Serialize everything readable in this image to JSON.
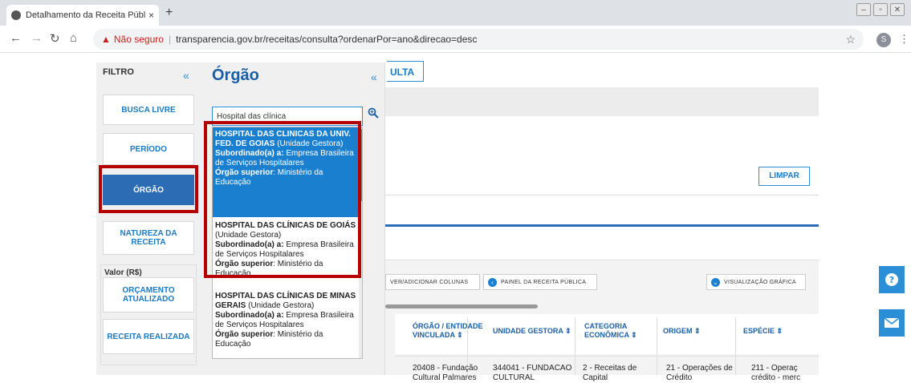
{
  "browser": {
    "tab_title": "Detalhamento da Receita Pública - P",
    "tab_close": "×",
    "new_tab": "+",
    "not_secure": "Não seguro",
    "url": "transparencia.gov.br/receitas/consulta?ordenarPor=ano&direcao=desc",
    "profile_initial": "S"
  },
  "filtro": {
    "title": "FILTRO",
    "collapse": "«",
    "buttons": {
      "busca_livre": "BUSCA LIVRE",
      "periodo": "PERÍODO",
      "orgao": "ÓRGÃO",
      "natureza": "NATUREZA DA RECEITA",
      "valor_title": "Valor (R$)",
      "orcamento": "ORÇAMENTO ATUALIZADO",
      "realizada": "RECEITA REALIZADA"
    }
  },
  "orgao_panel": {
    "title": "Órgão",
    "collapse": "«",
    "search_value": "Hospital das clínica",
    "results": [
      {
        "name": "HOSPITAL DAS CLINICAS DA UNIV. FED. DE GOIAS",
        "type": " (Unidade Gestora)",
        "sub_label": "Subordinado(a) a:",
        "sub_value": " Empresa Brasileira de Serviços Hospitalares",
        "sup_label": "Órgão superior",
        "sup_value": ": Ministério da Educação"
      },
      {
        "name": "HOSPITAL DAS CLÍNICAS DE GOIÁS",
        "type": " (Unidade Gestora)",
        "sub_label": "Subordinado(a) a:",
        "sub_value": " Empresa Brasileira de Serviços Hospitalares",
        "sup_label": "Órgão superior",
        "sup_value": ": Ministério da Educação"
      },
      {
        "name": "HOSPITAL DAS CLÍNICAS DE MINAS GERAIS",
        "type": " (Unidade Gestora)",
        "sub_label": "Subordinado(a) a:",
        "sub_value": " Empresa Brasileira de Serviços Hospitalares",
        "sup_label": "Órgão superior",
        "sup_value": ": Ministério da Educação"
      }
    ]
  },
  "main": {
    "consulta_tab": "ULTA",
    "limpar": "LIMPAR",
    "toolbar": {
      "colunas": "VER/ADICIONAR COLUNAS",
      "painel": "PAINEL DA RECEITA PÚBLICA",
      "grafica": "VISUALIZAÇÃO GRÁFICA"
    },
    "columns": [
      "ÓRGÃO / ENTIDADE VINCULADA ⇕",
      "UNIDADE GESTORA ⇕",
      "CATEGORIA ECONÔMICA ⇕",
      "ORIGEM ⇕",
      "ESPÉCIE ⇕"
    ],
    "row": [
      "20408 - Fundação Cultural Palmares",
      "344041 - FUNDACAO CULTURAL",
      "2 - Receitas de Capital",
      "21 - Operações de Crédito",
      "211 - Operaç crédito - merc"
    ]
  }
}
